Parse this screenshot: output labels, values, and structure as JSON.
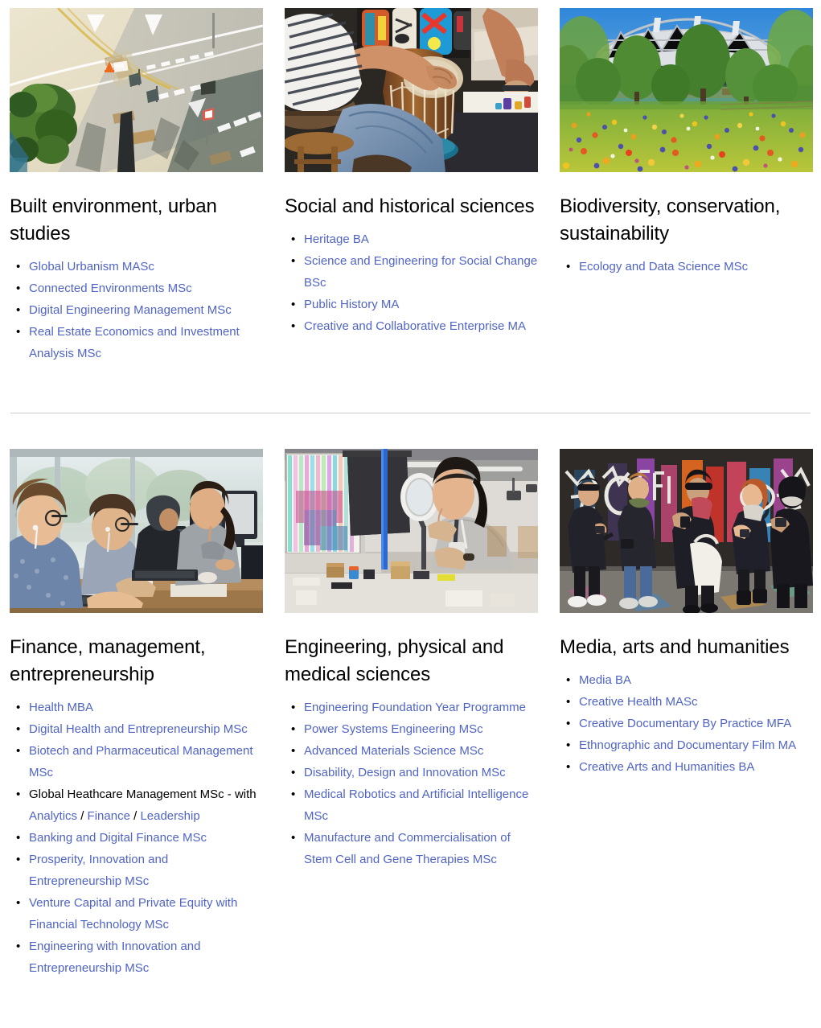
{
  "sections": [
    {
      "id": "row-1",
      "cards": [
        {
          "id": "built-environment",
          "image_name": "aerial-road-intersection-photo",
          "image_alt": "Aerial view of a road intersection with pale paving, white markings and a tree",
          "title": "Built environment, urban studies",
          "items": [
            {
              "type": "link",
              "label": "Global Urbanism MASc"
            },
            {
              "type": "link",
              "label": "Connected Environments MSc"
            },
            {
              "type": "link",
              "label": "Digital Engineering Management MSc"
            },
            {
              "type": "link",
              "label": "Real Estate Economics and Investment Analysis MSc"
            }
          ]
        },
        {
          "id": "social-historical",
          "image_name": "djembe-drummer-photo",
          "image_alt": "Person playing a djembe drum in front of colourful masks",
          "title": "Social and historical sciences",
          "items": [
            {
              "type": "link",
              "label": "Heritage BA"
            },
            {
              "type": "link",
              "label": "Science and Engineering for Social Change BSc"
            },
            {
              "type": "link",
              "label": "Public History MA"
            },
            {
              "type": "link",
              "label": "Creative and Collaborative Enterprise MA"
            }
          ]
        },
        {
          "id": "biodiversity",
          "image_name": "wildflower-meadow-stadium-photo",
          "image_alt": "Wildflower meadow in front of the Olympic stadium and trees",
          "title": "Biodiversity, conservation, sustainability",
          "items": [
            {
              "type": "link",
              "label": "Ecology and Data Science MSc"
            }
          ]
        }
      ]
    },
    {
      "id": "row-2",
      "cards": [
        {
          "id": "finance-management",
          "image_name": "computer-lab-students-photo",
          "image_alt": "Students working at computers in a bright lab",
          "title": "Finance, management, entrepreneurship",
          "items": [
            {
              "type": "link",
              "label": "Health MBA"
            },
            {
              "type": "link",
              "label": "Digital Health and Entrepreneurship MSc"
            },
            {
              "type": "link",
              "label": "Biotech and Pharmaceutical Management MSc"
            },
            {
              "type": "mixed",
              "parts": [
                {
                  "kind": "text",
                  "label": "Global Heathcare Management MSc - with "
                },
                {
                  "kind": "link",
                  "label": "Analytics"
                },
                {
                  "kind": "text",
                  "label": " / "
                },
                {
                  "kind": "link",
                  "label": "Finance"
                },
                {
                  "kind": "text",
                  "label": " / "
                },
                {
                  "kind": "link",
                  "label": "Leadership"
                }
              ]
            },
            {
              "type": "link",
              "label": "Banking and Digital Finance MSc"
            },
            {
              "type": "link",
              "label": "Prosperity, Innovation and Entrepreneurship MSc"
            },
            {
              "type": "link",
              "label": "Venture Capital and Private Equity with Financial Technology MSc"
            },
            {
              "type": "link",
              "label": "Engineering with Innovation and Entrepreneurship MSc"
            }
          ]
        },
        {
          "id": "engineering-physical-medical",
          "image_name": "researcher-magnifier-workshop-photo",
          "image_alt": "Researcher using a magnifier lamp at a workbench in a workshop",
          "title": "Engineering, physical and medical sciences",
          "items": [
            {
              "type": "link",
              "label": "Engineering Foundation Year Programme"
            },
            {
              "type": "link",
              "label": "Power Systems Engineering MSc"
            },
            {
              "type": "link",
              "label": "Advanced Materials Science MSc"
            },
            {
              "type": "link",
              "label": "Disability, Design and Innovation MSc"
            },
            {
              "type": "link",
              "label": "Medical Robotics and Artificial Intelligence MSc"
            },
            {
              "type": "link",
              "label": "Manufacture and Commercialisation of Stem Cell and Gene Therapies MSc"
            }
          ]
        },
        {
          "id": "media-arts-humanities",
          "image_name": "graffiti-wall-group-photo",
          "image_alt": "Group of people with cameras standing in front of a graffiti wall",
          "title": "Media, arts and humanities",
          "items": [
            {
              "type": "link",
              "label": "Media BA"
            },
            {
              "type": "link",
              "label": "Creative Health MASc"
            },
            {
              "type": "link",
              "label": "Creative Documentary By Practice MFA"
            },
            {
              "type": "link",
              "label": "Ethnographic and Documentary Film MA"
            },
            {
              "type": "link",
              "label": "Creative Arts and Humanities BA"
            }
          ]
        }
      ]
    }
  ],
  "colors": {
    "link": "#5064c8",
    "text": "#000000",
    "divider": "#c9cdd1",
    "background": "#ffffff"
  }
}
